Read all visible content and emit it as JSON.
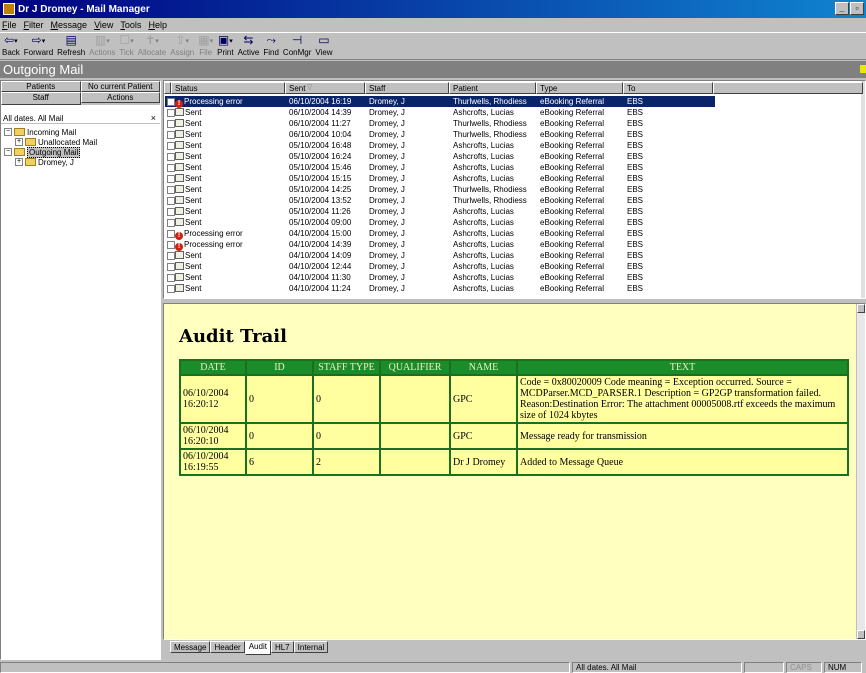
{
  "window": {
    "title": "Dr J Dromey - Mail Manager"
  },
  "menu": [
    "File",
    "Filter",
    "Message",
    "View",
    "Tools",
    "Help"
  ],
  "toolbar": [
    {
      "label": "Back",
      "icon": "back-arrow-icon",
      "glyph": "⇦",
      "enabled": true,
      "dropdown": true
    },
    {
      "label": "Forward",
      "icon": "forward-arrow-icon",
      "glyph": "⇨",
      "enabled": true,
      "dropdown": true
    },
    {
      "label": "Refresh",
      "icon": "refresh-icon",
      "glyph": "▤",
      "enabled": true,
      "dropdown": false
    },
    {
      "label": "Actions",
      "icon": "actions-icon",
      "glyph": "▥",
      "enabled": false,
      "dropdown": true
    },
    {
      "label": "Tick",
      "icon": "tick-icon",
      "glyph": "☐",
      "enabled": false,
      "dropdown": true
    },
    {
      "label": "Allocate",
      "icon": "allocate-icon",
      "glyph": "✝",
      "enabled": false,
      "dropdown": true
    },
    {
      "label": "Assign",
      "icon": "assign-icon",
      "glyph": "⇧",
      "enabled": false,
      "dropdown": true
    },
    {
      "label": "File",
      "icon": "file-icon",
      "glyph": "▦",
      "enabled": false,
      "dropdown": true
    },
    {
      "label": "Print",
      "icon": "print-icon",
      "glyph": "▣",
      "enabled": true,
      "dropdown": true
    },
    {
      "label": "Active",
      "icon": "active-icon",
      "glyph": "⇆",
      "enabled": true,
      "dropdown": false
    },
    {
      "label": "Find",
      "icon": "find-icon",
      "glyph": "⤳",
      "enabled": true,
      "dropdown": false
    },
    {
      "label": "ConMgr",
      "icon": "conmgr-icon",
      "glyph": "⊣",
      "enabled": true,
      "dropdown": false
    },
    {
      "label": "View",
      "icon": "view-icon",
      "glyph": "▭",
      "enabled": true,
      "dropdown": false
    }
  ],
  "page_title": "Outgoing Mail",
  "left": {
    "tabs_row1": [
      "Patients",
      "No current Patient"
    ],
    "tabs_row2": [
      "Staff",
      "Actions"
    ],
    "filter": "All dates. All Mail",
    "close": "×",
    "tree": [
      {
        "label": "Incoming Mail",
        "exp": "−",
        "indent": 0,
        "selected": false
      },
      {
        "label": "Unallocated Mail",
        "exp": "+",
        "indent": 1,
        "selected": false
      },
      {
        "label": "Outgoing Mail",
        "exp": "−",
        "indent": 0,
        "selected": true
      },
      {
        "label": "Dromey, J",
        "exp": "+",
        "indent": 1,
        "selected": false
      }
    ]
  },
  "list": {
    "columns": [
      "Status",
      "Sent",
      "Staff",
      "Patient",
      "Type",
      "To"
    ],
    "sort_glyph": "▽",
    "rows": [
      {
        "status": "Processing error",
        "kind": "error",
        "sent": "06/10/2004 16:19",
        "staff": "Dromey, J",
        "patient": "Thurlwells, Rhodiess",
        "type": "eBooking Referral",
        "to": "EBS",
        "selected": true
      },
      {
        "status": "Sent",
        "kind": "sent",
        "sent": "06/10/2004 14:39",
        "staff": "Dromey, J",
        "patient": "Ashcrofts, Lucias",
        "type": "eBooking Referral",
        "to": "EBS"
      },
      {
        "status": "Sent",
        "kind": "sent",
        "sent": "06/10/2004 11:27",
        "staff": "Dromey, J",
        "patient": "Thurlwells, Rhodiess",
        "type": "eBooking Referral",
        "to": "EBS"
      },
      {
        "status": "Sent",
        "kind": "sent",
        "sent": "06/10/2004 10:04",
        "staff": "Dromey, J",
        "patient": "Thurlwells, Rhodiess",
        "type": "eBooking Referral",
        "to": "EBS"
      },
      {
        "status": "Sent",
        "kind": "sent",
        "sent": "05/10/2004 16:48",
        "staff": "Dromey, J",
        "patient": "Ashcrofts, Lucias",
        "type": "eBooking Referral",
        "to": "EBS"
      },
      {
        "status": "Sent",
        "kind": "sent",
        "sent": "05/10/2004 16:24",
        "staff": "Dromey, J",
        "patient": "Ashcrofts, Lucias",
        "type": "eBooking Referral",
        "to": "EBS"
      },
      {
        "status": "Sent",
        "kind": "sent",
        "sent": "05/10/2004 15:46",
        "staff": "Dromey, J",
        "patient": "Ashcrofts, Lucias",
        "type": "eBooking Referral",
        "to": "EBS"
      },
      {
        "status": "Sent",
        "kind": "sent",
        "sent": "05/10/2004 15:15",
        "staff": "Dromey, J",
        "patient": "Ashcrofts, Lucias",
        "type": "eBooking Referral",
        "to": "EBS"
      },
      {
        "status": "Sent",
        "kind": "sent",
        "sent": "05/10/2004 14:25",
        "staff": "Dromey, J",
        "patient": "Thurlwells, Rhodiess",
        "type": "eBooking Referral",
        "to": "EBS"
      },
      {
        "status": "Sent",
        "kind": "sent",
        "sent": "05/10/2004 13:52",
        "staff": "Dromey, J",
        "patient": "Thurlwells, Rhodiess",
        "type": "eBooking Referral",
        "to": "EBS"
      },
      {
        "status": "Sent",
        "kind": "sent",
        "sent": "05/10/2004 11:26",
        "staff": "Dromey, J",
        "patient": "Ashcrofts, Lucias",
        "type": "eBooking Referral",
        "to": "EBS"
      },
      {
        "status": "Sent",
        "kind": "sent",
        "sent": "05/10/2004 09:00",
        "staff": "Dromey, J",
        "patient": "Ashcrofts, Lucias",
        "type": "eBooking Referral",
        "to": "EBS"
      },
      {
        "status": "Processing error",
        "kind": "error",
        "sent": "04/10/2004 15:00",
        "staff": "Dromey, J",
        "patient": "Ashcrofts, Lucias",
        "type": "eBooking Referral",
        "to": "EBS"
      },
      {
        "status": "Processing error",
        "kind": "error",
        "sent": "04/10/2004 14:39",
        "staff": "Dromey, J",
        "patient": "Ashcrofts, Lucias",
        "type": "eBooking Referral",
        "to": "EBS"
      },
      {
        "status": "Sent",
        "kind": "sent",
        "sent": "04/10/2004 14:09",
        "staff": "Dromey, J",
        "patient": "Ashcrofts, Lucias",
        "type": "eBooking Referral",
        "to": "EBS"
      },
      {
        "status": "Sent",
        "kind": "sent",
        "sent": "04/10/2004 12:44",
        "staff": "Dromey, J",
        "patient": "Ashcrofts, Lucias",
        "type": "eBooking Referral",
        "to": "EBS"
      },
      {
        "status": "Sent",
        "kind": "sent",
        "sent": "04/10/2004 11:30",
        "staff": "Dromey, J",
        "patient": "Ashcrofts, Lucias",
        "type": "eBooking Referral",
        "to": "EBS"
      },
      {
        "status": "Sent",
        "kind": "sent",
        "sent": "04/10/2004 11:24",
        "staff": "Dromey, J",
        "patient": "Ashcrofts, Lucias",
        "type": "eBooking Referral",
        "to": "EBS"
      }
    ]
  },
  "audit": {
    "title": "Audit Trail",
    "columns": [
      "DATE",
      "ID",
      "STAFF TYPE",
      "QUALIFIER",
      "NAME",
      "TEXT"
    ],
    "rows": [
      {
        "date": "06/10/2004 16:20:12",
        "id": "0",
        "staff_type": "0",
        "qualifier": "",
        "name": "GPC",
        "text": "Code = 0x80020009 Code meaning = Exception occurred. Source = MCDParser.MCD_PARSER.1 Description = GP2GP transformation failed. Reason:Destination Error: The attachment 00005008.rtf exceeds the maximum size of 1024 kbytes"
      },
      {
        "date": "06/10/2004 16:20:10",
        "id": "0",
        "staff_type": "0",
        "qualifier": "",
        "name": "GPC",
        "text": "Message ready for transmission"
      },
      {
        "date": "06/10/2004 16:19:55",
        "id": "6",
        "staff_type": "2",
        "qualifier": "",
        "name": "Dr J Dromey",
        "text": "Added to Message Queue"
      }
    ]
  },
  "bottom_tabs": [
    "Message",
    "Header",
    "Audit",
    "HL7",
    "Internal"
  ],
  "bottom_tab_selected": "Audit",
  "status": {
    "filter": "All dates. All Mail",
    "caps": "CAPS",
    "num": "NUM"
  },
  "colors": {
    "title_bar": "#000080",
    "selection": "#0a246a",
    "audit_bg": "#ffffc0",
    "audit_header": "#1a8c2a",
    "error": "#d02010"
  }
}
